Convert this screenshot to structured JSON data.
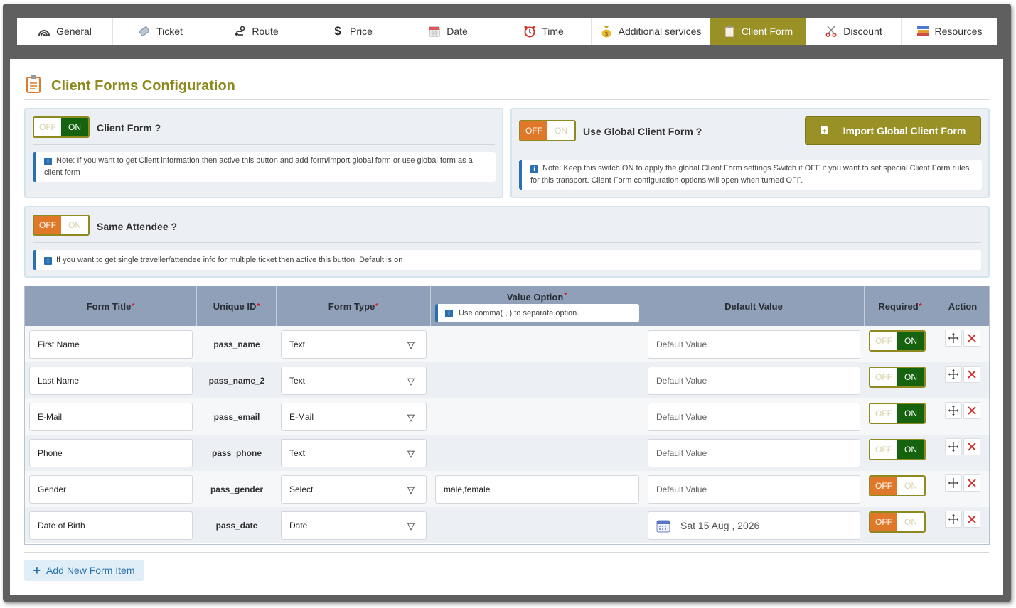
{
  "tabs": [
    {
      "label": "General",
      "icon": "rainbow-icon"
    },
    {
      "label": "Ticket",
      "icon": "ticket-icon"
    },
    {
      "label": "Route",
      "icon": "route-icon"
    },
    {
      "label": "Price",
      "icon": "dollar-icon"
    },
    {
      "label": "Date",
      "icon": "calendar-icon"
    },
    {
      "label": "Time",
      "icon": "alarm-clock-icon"
    },
    {
      "label": "Additional services",
      "icon": "money-bag-icon"
    },
    {
      "label": "Client Form",
      "icon": "clipboard-icon",
      "active": true
    },
    {
      "label": "Discount",
      "icon": "scissors-icon"
    },
    {
      "label": "Resources",
      "icon": "books-icon"
    }
  ],
  "page_title": "Client Forms Configuration",
  "client_form": {
    "label": "Client Form ?",
    "toggle": {
      "off": "OFF",
      "on": "ON",
      "state": "on"
    },
    "note": "Note: If you want to get Client information then active this button and add form/import global form or use global form as a client form"
  },
  "global_form": {
    "label": "Use Global Client Form ?",
    "toggle": {
      "off": "OFF",
      "on": "ON",
      "state": "off"
    },
    "import_button": "Import Global Client Form",
    "note": "Note: Keep this switch ON to apply the global Client Form settings.Switch it OFF if you want to set special Client Form rules for this transport. Client Form configuration options will open when turned OFF."
  },
  "same_attendee": {
    "label": "Same Attendee ?",
    "toggle": {
      "off": "OFF",
      "on": "ON",
      "state": "off"
    },
    "note": "If you want to get single traveller/attendee info for multiple ticket then active this button .Default is on"
  },
  "table": {
    "headers": {
      "form_title": "Form Title",
      "unique_id": "Unique ID",
      "form_type": "Form Type",
      "value_option": "Value Option",
      "value_option_note": "Use comma( , ) to separate option.",
      "default_value": "Default Value",
      "required": "Required",
      "action": "Action"
    },
    "default_placeholder": "Default Value",
    "rows": [
      {
        "title": "First Name",
        "uid": "pass_name",
        "type": "Text",
        "option": "",
        "default": "",
        "required": "on"
      },
      {
        "title": "Last Name",
        "uid": "pass_name_2",
        "type": "Text",
        "option": "",
        "default": "",
        "required": "on"
      },
      {
        "title": "E-Mail",
        "uid": "pass_email",
        "type": "E-Mail",
        "option": "",
        "default": "",
        "required": "on"
      },
      {
        "title": "Phone",
        "uid": "pass_phone",
        "type": "Text",
        "option": "",
        "default": "",
        "required": "on"
      },
      {
        "title": "Gender",
        "uid": "pass_gender",
        "type": "Select",
        "option": "male,female",
        "default": "",
        "required": "off"
      },
      {
        "title": "Date of Birth",
        "uid": "pass_date",
        "type": "Date",
        "option": "",
        "default": "Sat 15 Aug , 2026",
        "required": "off"
      }
    ]
  },
  "add_button": "Add New Form Item",
  "colors": {
    "accent": "#999126",
    "on": "#15620f",
    "off": "#e0782a",
    "header": "#8fa0b8",
    "info": "#2a6fb0"
  }
}
